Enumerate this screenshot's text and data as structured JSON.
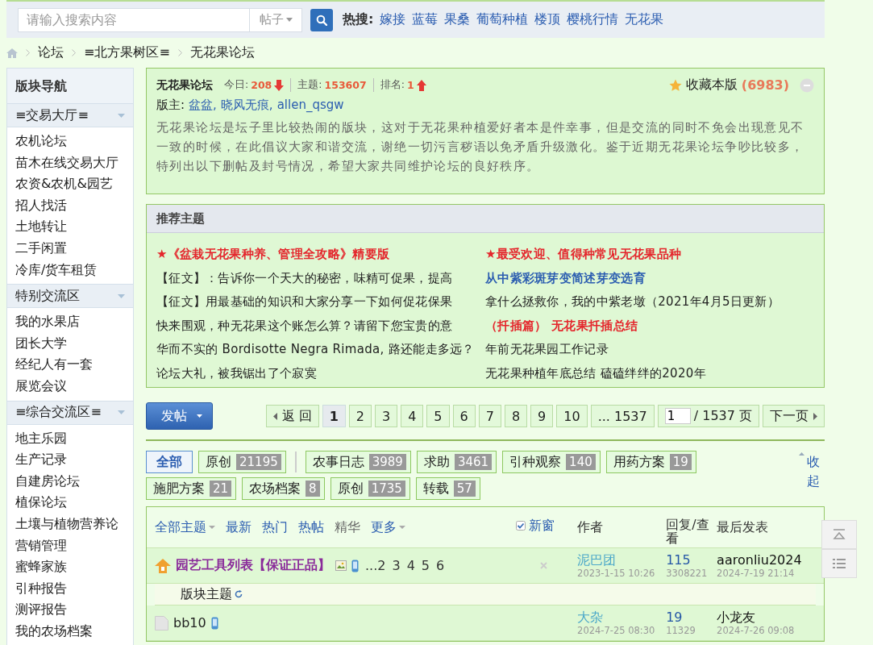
{
  "search": {
    "placeholder": "请输入搜索内容",
    "scope": "帖子",
    "hot_label": "热搜:",
    "hot_keywords": [
      "嫁接",
      "蓝莓",
      "果桑",
      "葡萄种植",
      "楼顶",
      "樱桃行情",
      "无花果"
    ]
  },
  "breadcrumb": [
    "论坛",
    "≡北方果树区≡",
    "无花果论坛"
  ],
  "sidebar": {
    "title": "版块导航",
    "groups": [
      {
        "title": "≡交易大厅≡",
        "expanded": true,
        "items": [
          "农机论坛",
          "苗木在线交易大厅",
          "农资&农机&园艺",
          "招人找活",
          "土地转让",
          "二手闲置",
          "冷库/货车租赁"
        ]
      },
      {
        "title": "特别交流区",
        "expanded": true,
        "items": [
          "我的水果店",
          "团长大学",
          "经纪人有一套",
          "展览会议"
        ]
      },
      {
        "title": "≡综合交流区≡",
        "expanded": true,
        "items": [
          "地主乐园",
          "生产记录",
          "自建房论坛",
          "植保论坛",
          "土壤与植物营养论",
          "营销管理",
          "蜜蜂家族",
          "引种报告",
          "测评报告",
          "我的农场档案"
        ]
      }
    ]
  },
  "forum": {
    "name": "无花果论坛",
    "stats": [
      {
        "label": "今日:",
        "value": "208",
        "falling": true,
        "rising": false
      },
      {
        "label": "主题:",
        "value": "153607",
        "falling": false,
        "rising": false
      },
      {
        "label": "排名:",
        "value": "1",
        "falling": false,
        "rising": true
      }
    ],
    "favorite": {
      "label": "收藏本版",
      "count": "(6983)"
    },
    "moderators_label": "版主:",
    "moderators": [
      "盆盆,",
      "晓风无痕,",
      "allen_qsgw"
    ],
    "description": "无花果论坛是坛子里比较热闹的版块，这对于无花果种植爱好者本是件幸事，但是交流的同时不免会出现意见不一致的时候，在此倡议大家和谐交流，谢绝一切污言秽语以免矛盾升级激化。鉴于近期无花果论坛争吵比较多，特列出以下删帖及封号情况，希望大家共同维护论坛的良好秩序。"
  },
  "recommended": {
    "title": "推荐主题",
    "items": [
      {
        "text": "★《盆栽无花果种养、管理全攻略》精要版",
        "kind": "highlight"
      },
      {
        "text": "★最受欢迎、值得种常见无花果品种",
        "kind": "highlight"
      },
      {
        "text": "【征文】：告诉你一个天大的秘密，味精可促果，提高",
        "kind": "plain"
      },
      {
        "text": "从中紫彩斑芽变简述芽变选育",
        "kind": "link"
      },
      {
        "text": "【征文】用最基础的知识和大家分享一下如何促花保果",
        "kind": "plain"
      },
      {
        "text": "拿什么拯救你，我的中紫老墩（2021年4月5日更新）",
        "kind": "plain"
      },
      {
        "text": "快来围观，种无花果这个账怎么算？请留下您宝贵的意",
        "kind": "plain"
      },
      {
        "text": "（扦插篇） 无花果扦插总结",
        "kind": "highlight"
      },
      {
        "text": "华而不实的 Bordisotte Negra Rimada, 路还能走多远？",
        "kind": "plain"
      },
      {
        "text": "年前无花果园工作记录",
        "kind": "plain"
      },
      {
        "text": "论坛大礼，被我锯出了个寂寞",
        "kind": "plain"
      },
      {
        "text": "无花果种植年底总结 磕磕绊绊的2020年",
        "kind": "plain"
      }
    ]
  },
  "toolbar": {
    "post_button": "发帖",
    "prev": "返 回",
    "pages": [
      {
        "label": "1",
        "selected": true
      },
      {
        "label": "2",
        "selected": false
      },
      {
        "label": "3",
        "selected": false
      },
      {
        "label": "4",
        "selected": false
      },
      {
        "label": "5",
        "selected": false
      },
      {
        "label": "6",
        "selected": false
      },
      {
        "label": "7",
        "selected": false
      },
      {
        "label": "8",
        "selected": false
      },
      {
        "label": "9",
        "selected": false
      },
      {
        "label": "10",
        "selected": false
      },
      {
        "label": "... 1537",
        "selected": false
      }
    ],
    "page_input": "1",
    "total": "/ 1537 页",
    "next": "下一页"
  },
  "filters": {
    "tags": [
      {
        "label": "全部",
        "selected": true
      },
      {
        "label": "原创",
        "count": "21195",
        "selected": false,
        "divider_after": true
      },
      {
        "label": "农事日志",
        "count": "3989",
        "selected": false
      },
      {
        "label": "求助",
        "count": "3461",
        "selected": false
      },
      {
        "label": "引种观察",
        "count": "140",
        "selected": false
      },
      {
        "label": "用药方案",
        "count": "19",
        "selected": false
      },
      {
        "label": "施肥方案",
        "count": "21",
        "selected": false
      },
      {
        "label": "农场档案",
        "count": "8",
        "selected": false
      },
      {
        "label": "原创",
        "count": "1735",
        "selected": false
      },
      {
        "label": "转载",
        "count": "57",
        "selected": false
      }
    ],
    "collapse": "收起"
  },
  "threads": {
    "tabs": [
      {
        "label": "全部主题",
        "dropdown": true,
        "selected": false
      },
      {
        "label": "最新",
        "selected": false
      },
      {
        "label": "热门",
        "selected": false
      },
      {
        "label": "热帖",
        "selected": false
      },
      {
        "label": "精华",
        "selected": true
      },
      {
        "label": "更多",
        "dropdown": true,
        "selected": false
      }
    ],
    "new_window": {
      "label": "新窗",
      "checked": true
    },
    "columns": [
      "作者",
      "回复/查看",
      "最后发表"
    ],
    "rows": [
      {
        "kind": "thread",
        "pinned": true,
        "title": "园艺工具列表【保证正品】",
        "featured": true,
        "has_image": true,
        "mobile": true,
        "pages": [
          "...2",
          "3",
          "4",
          "5",
          "6"
        ],
        "closable": true,
        "author": "泥巴团",
        "posted": "2023-1-15 10:26",
        "replies": "115",
        "views": "3308221",
        "last_user": "aaronliu2024",
        "last_time": "2024-7-19 21:14"
      },
      {
        "kind": "section",
        "title": "版块主题"
      },
      {
        "kind": "thread",
        "pinned": false,
        "title": "bb10",
        "featured": false,
        "has_image": false,
        "mobile": true,
        "closable": false,
        "author": "大杂",
        "posted": "2024-7-25 08:30",
        "replies": "19",
        "views": "11329",
        "last_user": "小龙友",
        "last_time": "2024-7-26 09:08"
      }
    ]
  }
}
